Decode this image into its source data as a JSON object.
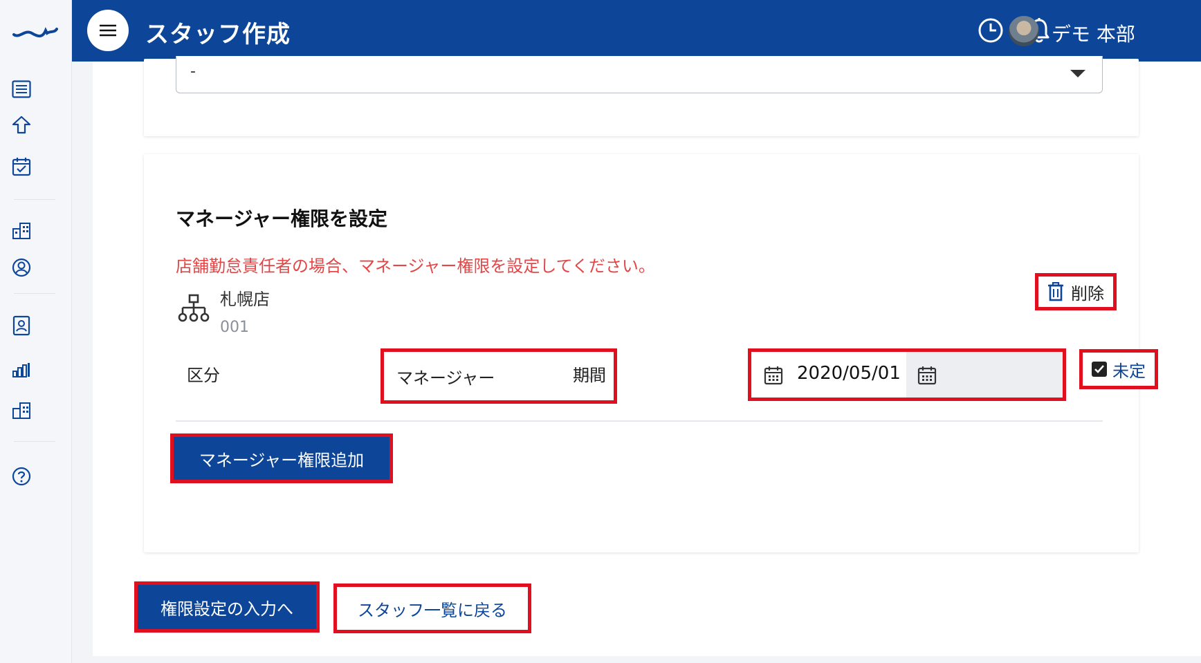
{
  "header": {
    "title": "スタッフ作成",
    "user_name": "デモ 本部"
  },
  "top_select": {
    "value": "-"
  },
  "manager_section": {
    "title": "マネージャー権限を設定",
    "notice": "店舗勤怠責任者の場合、マネージャー権限を設定してください。",
    "store_name": "札幌店",
    "store_code": "001",
    "delete_label": "削除",
    "category_label": "区分",
    "category_value": "マネージャー",
    "period_label": "期間",
    "period_start": "2020/05/01",
    "undecided_label": "未定",
    "add_button": "マネージャー権限追加"
  },
  "footer": {
    "next_button": "権限設定の入力へ",
    "back_button": "スタッフ一覧に戻る"
  },
  "colors": {
    "brand": "#0d4699",
    "highlight": "#e0101f",
    "notice": "#e24646"
  }
}
